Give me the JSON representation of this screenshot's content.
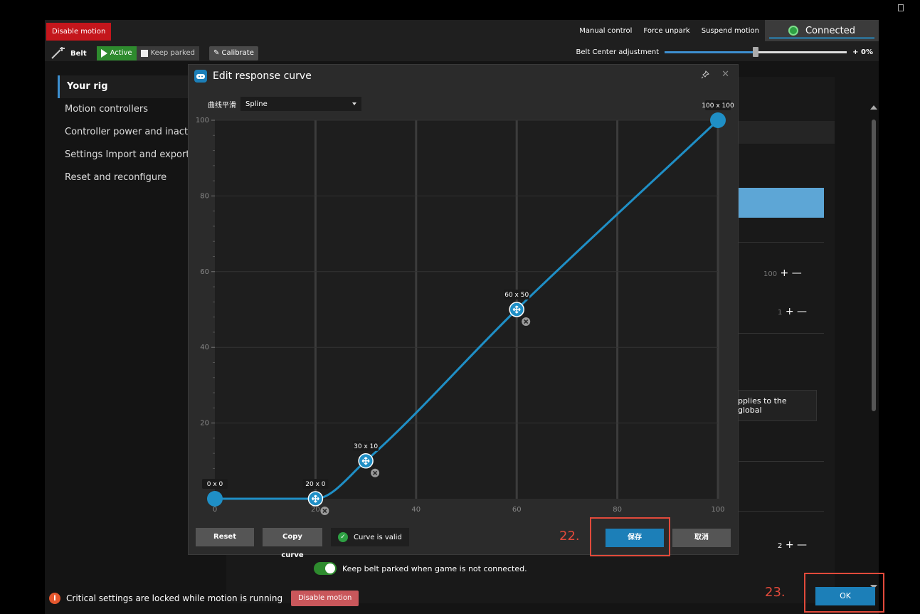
{
  "topbar": {
    "disable_motion_label": "Disable motion",
    "menu": [
      "Manual control",
      "Force unpark",
      "Suspend motion"
    ],
    "status": "Connected",
    "belt_label": "Belt",
    "active_label": "Active",
    "keep_parked_label": "Keep parked",
    "calibrate_label": "Calibrate",
    "belt_center_label": "Belt Center adjustment",
    "belt_center_value": "+ 0%",
    "belt_center_level": 0.5
  },
  "sidebar": {
    "items": [
      {
        "label": "Your rig"
      },
      {
        "label": "Motion controllers"
      },
      {
        "label": "Controller power and inactivit"
      },
      {
        "label": "Settings Import and export"
      },
      {
        "label": "Reset and reconfigure"
      }
    ]
  },
  "background": {
    "tooltip_fragment": "pplies to the global",
    "stepper_1": "100",
    "stepper_2": "1",
    "stepper_3": "2",
    "keep_parked_toggle_label": "Keep belt parked when game is not connected."
  },
  "footer": {
    "warning": "Critical settings are locked while motion is running",
    "disable_motion_label": "Disable motion",
    "ok_label": "OK"
  },
  "dialog": {
    "title": "Edit response curve",
    "smoothing_label": "曲线平滑",
    "smoothing_value": "Spline",
    "reset_label": "Reset",
    "copy_label": "Copy curve",
    "valid_label": "Curve is valid",
    "save_label": "保存",
    "cancel_label": "取消"
  },
  "annotations": {
    "step_22": "22.",
    "step_23": "23."
  },
  "chart_data": {
    "type": "line",
    "x_ticks": [
      "0",
      "20",
      "40",
      "60",
      "80",
      "100"
    ],
    "y_ticks": [
      "20",
      "40",
      "60",
      "80",
      "100"
    ],
    "xlim": [
      0,
      100
    ],
    "ylim": [
      0,
      100
    ],
    "grid": true,
    "points": [
      {
        "x": 0,
        "y": 0,
        "label": "0 x 0"
      },
      {
        "x": 20,
        "y": 0,
        "label": "20 x 0"
      },
      {
        "x": 30,
        "y": 10,
        "label": "30 x 10"
      },
      {
        "x": 60,
        "y": 50,
        "label": "60 x 50"
      },
      {
        "x": 100,
        "y": 100,
        "label": "100 x 100"
      }
    ],
    "line_color": "#1f8fc6"
  }
}
